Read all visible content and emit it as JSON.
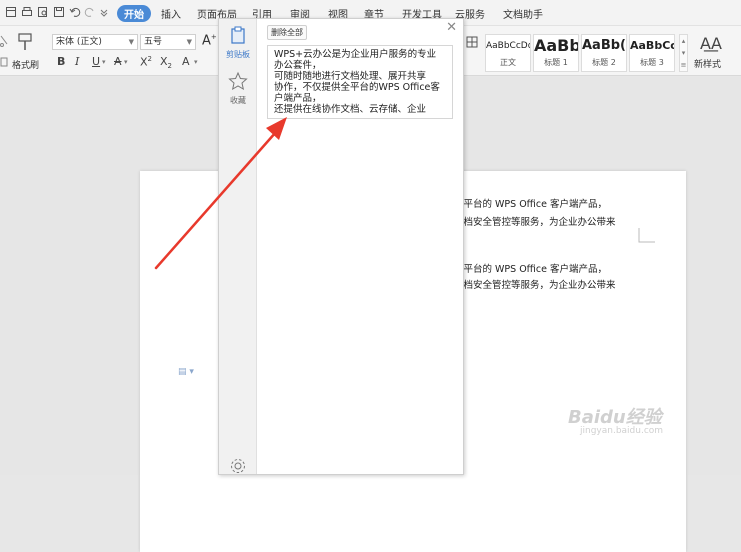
{
  "menu": {
    "tabs": [
      "开始",
      "插入",
      "页面布局",
      "引用",
      "审阅",
      "视图",
      "章节",
      "开发工具",
      "云服务",
      "文档助手"
    ],
    "active": "开始"
  },
  "ribbon": {
    "font_name": "宋体 (正文)",
    "font_size": "五号",
    "format_painter": "格式刷",
    "styles": [
      {
        "sample": "AaBbCcDd",
        "label": "正文"
      },
      {
        "sample": "AaBb",
        "label": "标题 1"
      },
      {
        "sample": "AaBb(",
        "label": "标题 2"
      },
      {
        "sample": "AaBbCcI",
        "label": "标题 3"
      }
    ],
    "new_style": "新样式"
  },
  "panel": {
    "side_clipboard": "剪贴板",
    "side_favorites": "收藏",
    "clear_all": "删除全部",
    "clip_lines": [
      "WPS+云办公是为企业用户服务的专业",
      "办公套件，",
      "可随时随地进行文档处理、展开共享",
      "协作，不仅提供全平台的WPS Office客",
      "户端产品，",
      "还提供在线协作文档、云存储、企业"
    ]
  },
  "document": {
    "lines": [
      "全平台的 WPS Office 客户端产品，",
      "文档安全管控等服务，为企业办公带来",
      "全平台的 WPS Office 客户端产品，",
      "文档安全管控等服务，为企业办公带来"
    ]
  },
  "watermark": {
    "brand": "Baidu经验",
    "url": "jingyan.baidu.com"
  },
  "colors": {
    "accent": "#4a8ad6",
    "arrow": "#e8392c"
  }
}
